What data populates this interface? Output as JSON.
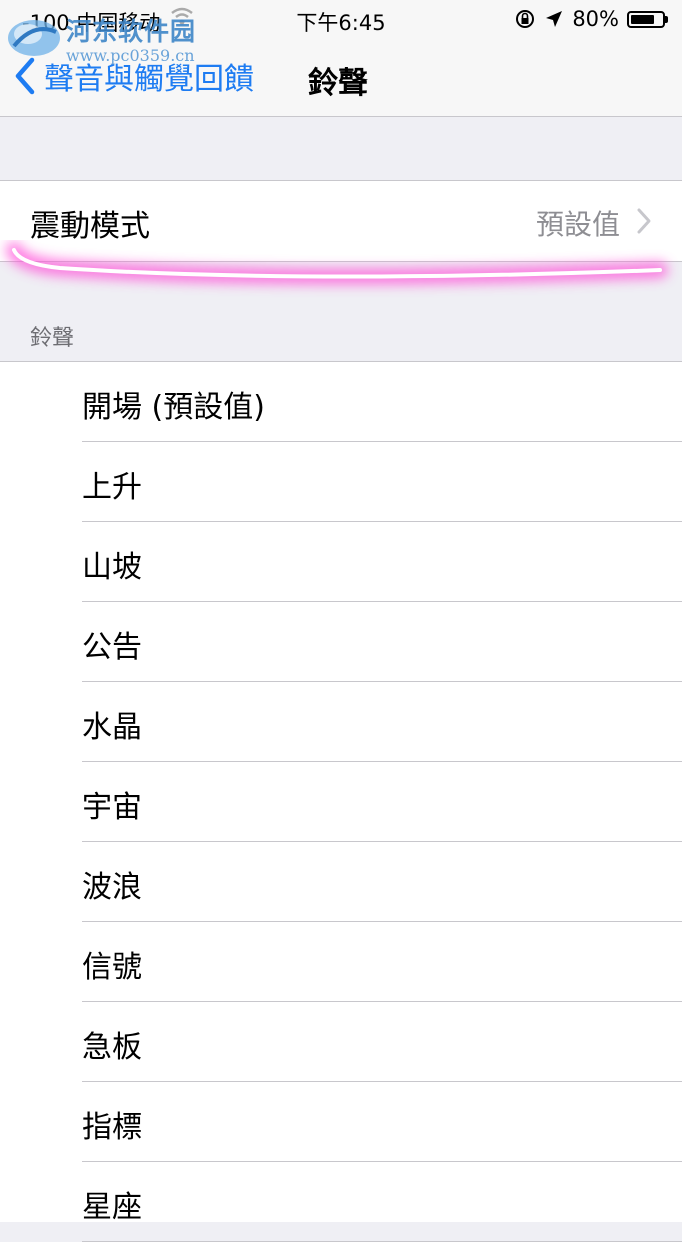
{
  "status_bar": {
    "carrier": "-100 中国移动",
    "time": "下午6:45",
    "battery_percent": "80%",
    "battery_level": 0.8,
    "icons": [
      "wifi-icon",
      "rotation-lock-icon",
      "location-arrow-icon",
      "battery-icon"
    ]
  },
  "watermark": {
    "text": "河东软件园",
    "url": "www.pc0359.cn"
  },
  "nav": {
    "back_label": "聲音與觸覺回饋",
    "title": "鈴聲"
  },
  "vibration": {
    "label": "震動模式",
    "value": "預設值"
  },
  "ringtones": {
    "header": "鈴聲",
    "items": [
      {
        "label": "開場 (預設值)"
      },
      {
        "label": "上升"
      },
      {
        "label": "山坡"
      },
      {
        "label": "公告"
      },
      {
        "label": "水晶"
      },
      {
        "label": "宇宙"
      },
      {
        "label": "波浪"
      },
      {
        "label": "信號"
      },
      {
        "label": "急板"
      },
      {
        "label": "指標"
      },
      {
        "label": "星座"
      }
    ]
  },
  "colors": {
    "accent": "#1e7cf2",
    "background": "#efeff4",
    "highlight": "#ff4fd8"
  }
}
